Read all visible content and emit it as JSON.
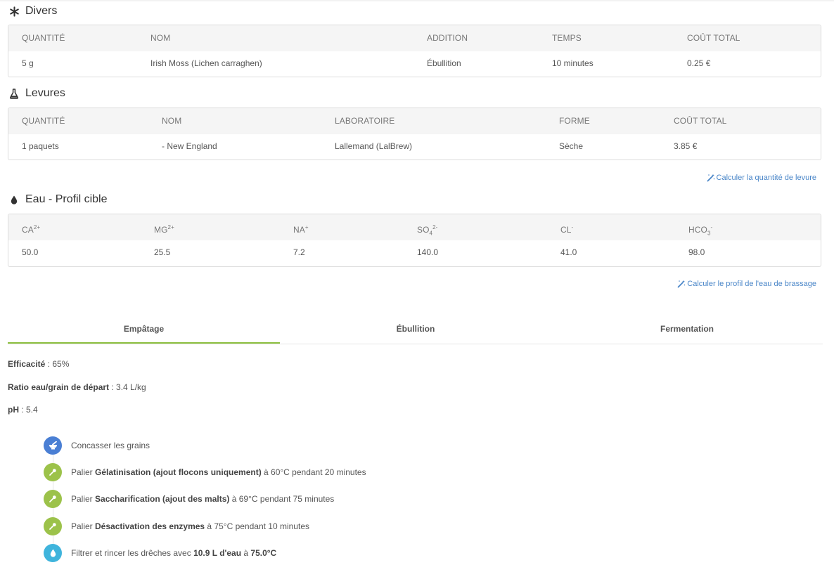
{
  "divers": {
    "title": "Divers",
    "icon": "asterisk-icon",
    "headers": [
      "QUANTITÉ",
      "NOM",
      "ADDITION",
      "TEMPS",
      "COÛT TOTAL"
    ],
    "row": [
      "5 g",
      "Irish Moss (Lichen carraghen)",
      "Ébullition",
      "10 minutes",
      "0.25 €"
    ]
  },
  "levures": {
    "title": "Levures",
    "icon": "flask-icon",
    "headers": [
      "QUANTITÉ",
      "NOM",
      "LABORATOIRE",
      "FORME",
      "COÛT TOTAL"
    ],
    "row": [
      "1 paquets",
      "- New England",
      "Lallemand (LalBrew)",
      "Sèche",
      "3.85 €"
    ],
    "link": "Calculer la quantité de levure"
  },
  "eau": {
    "title": "Eau - Profil cible",
    "icon": "drop-icon",
    "headers": [
      {
        "base": "CA",
        "sup": "2+",
        "sub": ""
      },
      {
        "base": "MG",
        "sup": "2+",
        "sub": ""
      },
      {
        "base": "NA",
        "sup": "+",
        "sub": ""
      },
      {
        "base": "SO",
        "sub": "4",
        "sup": "2-"
      },
      {
        "base": "CL",
        "sup": "-",
        "sub": ""
      },
      {
        "base": "HCO",
        "sub": "3",
        "sup": "-"
      }
    ],
    "row": [
      "50.0",
      "25.5",
      "7.2",
      "140.0",
      "41.0",
      "98.0"
    ],
    "link": "Calculer le profil de l'eau de brassage"
  },
  "tabs": [
    "Empâtage",
    "Ébullition",
    "Fermentation"
  ],
  "active_tab": "Empâtage",
  "accent_color": "#8cbf3f",
  "link_color": "#4a86c8",
  "mash": {
    "efficacite_label": "Efficacité",
    "efficacite_value": " : 65%",
    "ratio_label": "Ratio eau/grain de départ",
    "ratio_value": " : 3.4 L/kg",
    "ph_label": "pH",
    "ph_value": " : 5.4"
  },
  "steps": [
    {
      "icon": "mortar-icon",
      "color": "#4a7fd4",
      "pre": "Concasser les grains",
      "bold": "",
      "post": ""
    },
    {
      "icon": "thermometer-icon",
      "color": "#9cc24a",
      "pre": "Palier ",
      "bold": "Gélatinisation (ajout flocons uniquement)",
      "post": " à 60°C pendant 20 minutes"
    },
    {
      "icon": "thermometer-icon",
      "color": "#9cc24a",
      "pre": "Palier ",
      "bold": "Saccharification (ajout des malts)",
      "post": " à 69°C pendant 75 minutes"
    },
    {
      "icon": "thermometer-icon",
      "color": "#9cc24a",
      "pre": "Palier ",
      "bold": "Désactivation des enzymes",
      "post": " à 75°C pendant 10 minutes"
    },
    {
      "icon": "water-drop-icon",
      "color": "#3fb4dc",
      "pre": "Filtrer et rincer les drêches avec ",
      "bold": "10.9 L d'eau",
      "post": " à ",
      "bold2": "75.0°C"
    }
  ]
}
